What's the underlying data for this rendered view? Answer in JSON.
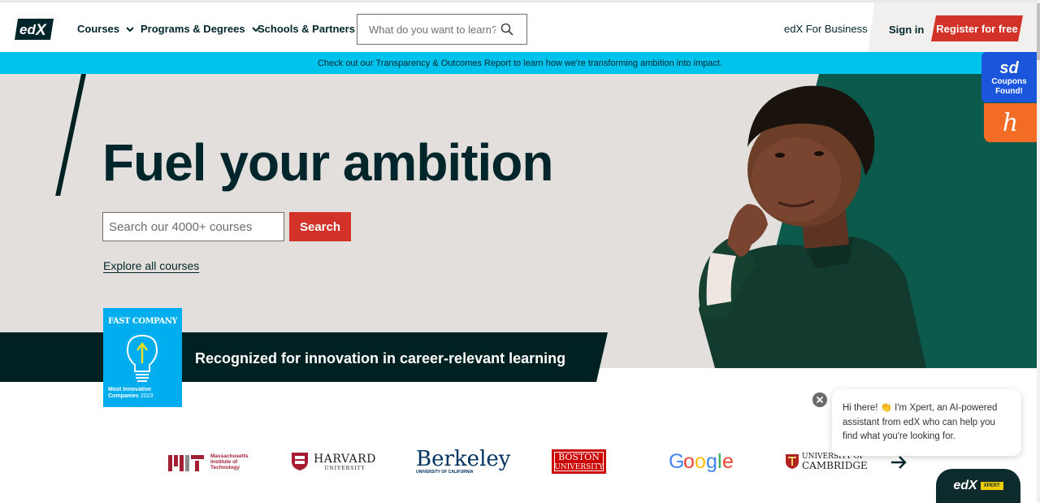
{
  "header": {
    "logo_text": "edX",
    "nav": [
      {
        "label": "Courses",
        "has_dropdown": true
      },
      {
        "label": "Programs & Degrees",
        "has_dropdown": true
      },
      {
        "label": "Schools & Partners",
        "has_dropdown": false
      }
    ],
    "search_placeholder": "What do you want to learn?",
    "business_label": "edX For Business",
    "signin_label": "Sign in",
    "register_label": "Register for free"
  },
  "banner": {
    "prefix": "Check out our",
    "link": "Transparency & Outcomes Report",
    "suffix": "to learn how we're transforming ambition into impact."
  },
  "hero": {
    "title": "Fuel your ambition",
    "search_placeholder": "Search our 4000+ courses",
    "search_button": "Search",
    "explore_link": "Explore all courses"
  },
  "recognition": {
    "text": "Recognized for innovation in career-relevant learning",
    "badge_brand": "FAST COMPANY",
    "badge_line1": "Most Innovative",
    "badge_line2": "Companies",
    "badge_year": "2023"
  },
  "partners": [
    {
      "name": "MIT",
      "line1": "Massachusetts",
      "line2": "Institute of",
      "line3": "Technology"
    },
    {
      "name": "HARVARD",
      "sub": "UNIVERSITY"
    },
    {
      "name": "Berkeley",
      "sub": "UNIVERSITY OF CALIFORNIA"
    },
    {
      "name": "BOSTON",
      "sub": "UNIVERSITY"
    },
    {
      "name": "Google"
    },
    {
      "name": "UNIVERSITY OF",
      "sub": "CAMBRIDGE"
    }
  ],
  "widgets": {
    "coupon_logo": "sd",
    "coupon_line1": "Coupons",
    "coupon_line2": "Found!",
    "honey_logo": "h"
  },
  "chat": {
    "message": "Hi there! 👏 I'm Xpert, an AI-powered assistant from edX who can help you find what you're looking for.",
    "button_logo": "edX",
    "button_tag": "XPERT"
  },
  "colors": {
    "brand_red": "#d23228",
    "banner_cyan": "#00c3ed",
    "dark_teal": "#00262b",
    "hero_green": "#0b5a4c"
  }
}
